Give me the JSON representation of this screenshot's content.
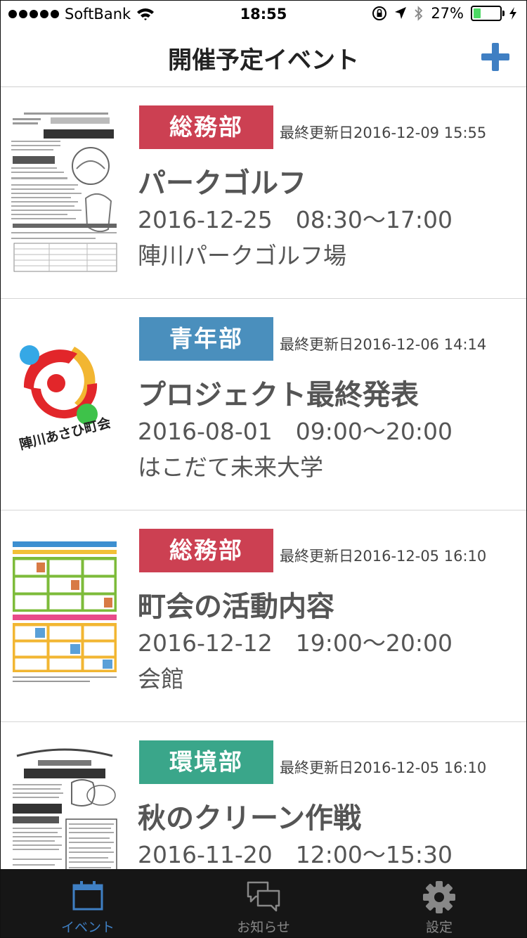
{
  "status_bar": {
    "carrier": "SoftBank",
    "time": "18:55",
    "battery_text": "27%",
    "battery_level": 0.27
  },
  "nav": {
    "title": "開催予定イベント",
    "add_icon": "plus-icon"
  },
  "events": [
    {
      "dept": "総務部",
      "dept_color": "#cc4052",
      "updated": "最終更新日2016-12-09 15:55",
      "title": "パークゴルフ",
      "datetime": "2016-12-25　08:30〜17:00",
      "place": "陣川パークゴルフ場",
      "thumbnail": "flyer"
    },
    {
      "dept": "青年部",
      "dept_color": "#4a8fbd",
      "updated": "最終更新日2016-12-06 14:14",
      "title": "プロジェクト最終発表",
      "datetime": "2016-08-01　09:00〜20:00",
      "place": "はこだて未来大学",
      "thumbnail": "logo",
      "logo_text": "陣川あさひ町会"
    },
    {
      "dept": "総務部",
      "dept_color": "#cc4052",
      "updated": "最終更新日2016-12-05 16:10",
      "title": "町会の活動内容",
      "datetime": "2016-12-12　19:00〜20:00",
      "place": "会館",
      "thumbnail": "activity"
    },
    {
      "dept": "環境部",
      "dept_color": "#3aa68a",
      "updated": "最終更新日2016-12-05 16:10",
      "title": "秋のクリーン作戦",
      "datetime": "2016-11-20　12:00〜15:30",
      "place": "",
      "thumbnail": "cleanup"
    }
  ],
  "tabs": [
    {
      "label": "イベント",
      "icon": "calendar-icon",
      "active": true
    },
    {
      "label": "お知らせ",
      "icon": "chat-bubbles-icon",
      "active": false
    },
    {
      "label": "設定",
      "icon": "gear-icon",
      "active": false
    }
  ],
  "colors": {
    "accent": "#3f7fc3",
    "tab_bar": "#161616",
    "tab_inactive": "#888888"
  }
}
